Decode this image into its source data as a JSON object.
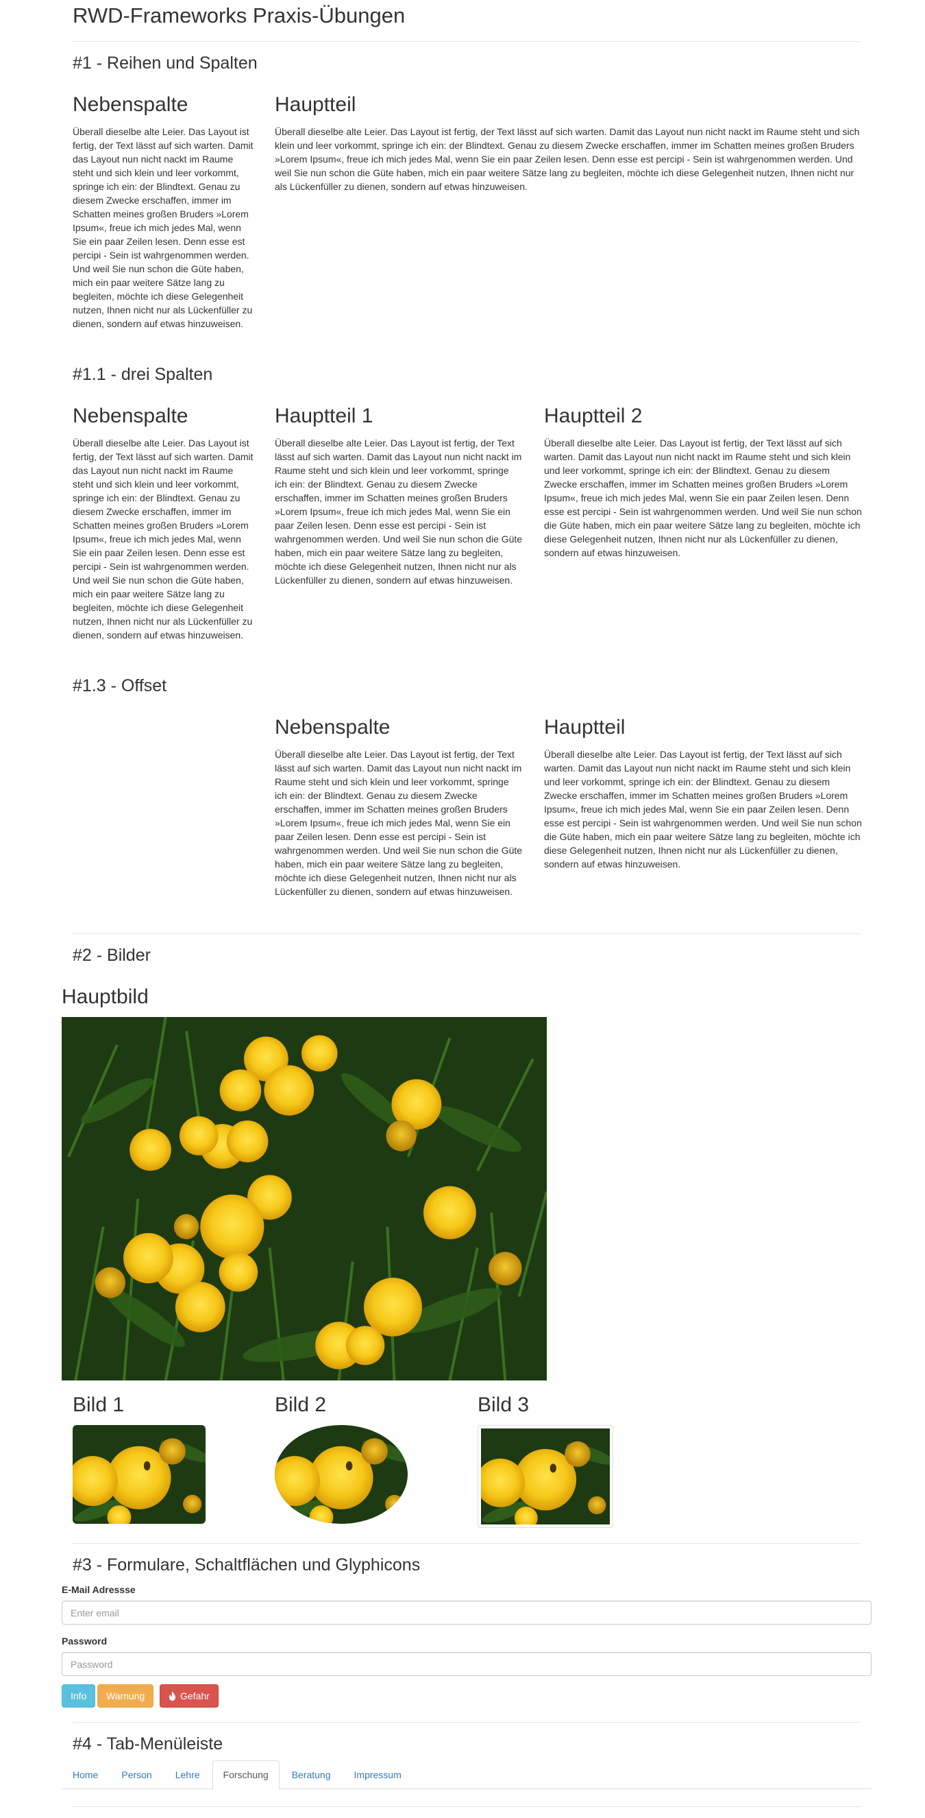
{
  "page_title": "RWD-Frameworks Praxis-Übungen",
  "lorem": "Überall dieselbe alte Leier. Das Layout ist fertig, der Text lässt auf sich warten. Damit das Layout nun nicht nackt im Raume steht und sich klein und leer vorkommt, springe ich ein: der Blindtext. Genau zu diesem Zwecke erschaffen, immer im Schatten meines großen Bruders »Lorem Ipsum«, freue ich mich jedes Mal, wenn Sie ein paar Zeilen lesen. Denn esse est percipi - Sein ist wahrgenommen werden. Und weil Sie nun schon die Güte haben, mich ein paar weitere Sätze lang zu begleiten, möchte ich diese Gelegenheit nutzen, Ihnen nicht nur als Lückenfüller zu dienen, sondern auf etwas hinzuweisen.",
  "section1": {
    "title": "#1 - Reihen und Spalten",
    "col1_heading": "Nebenspalte",
    "col2_heading": "Hauptteil"
  },
  "section11": {
    "title": "#1.1 - drei Spalten",
    "col1_heading": "Nebenspalte",
    "col2_heading": "Hauptteil 1",
    "col3_heading": "Hauptteil 2"
  },
  "section13": {
    "title": "#1.3 - Offset",
    "col1_heading": "Nebenspalte",
    "col2_heading": "Hauptteil"
  },
  "section2": {
    "title": "#2 - Bilder",
    "main_image_heading": "Hauptbild",
    "thumbs": [
      {
        "heading": "Bild 1"
      },
      {
        "heading": "Bild 2"
      },
      {
        "heading": "Bild 3"
      }
    ]
  },
  "section3": {
    "title": "#3 - Formulare, Schaltflächen und Glyphicons",
    "email_label": "E-Mail Adressse",
    "email_placeholder": "Enter email",
    "password_label": "Password",
    "password_placeholder": "Password",
    "buttons": {
      "info": "Info",
      "warning": "Warnung",
      "danger": "Gefahr"
    },
    "danger_icon": "fire-icon"
  },
  "section4": {
    "title": "#4 - Tab-Menüleiste",
    "tabs": [
      "Home",
      "Person",
      "Lehre",
      "Forschung",
      "Beratung",
      "Impressum"
    ],
    "active_tab": "Forschung"
  },
  "colors": {
    "link": "#337ab7",
    "info": "#5bc0de",
    "warning": "#f0ad4e",
    "danger": "#d9534f"
  }
}
